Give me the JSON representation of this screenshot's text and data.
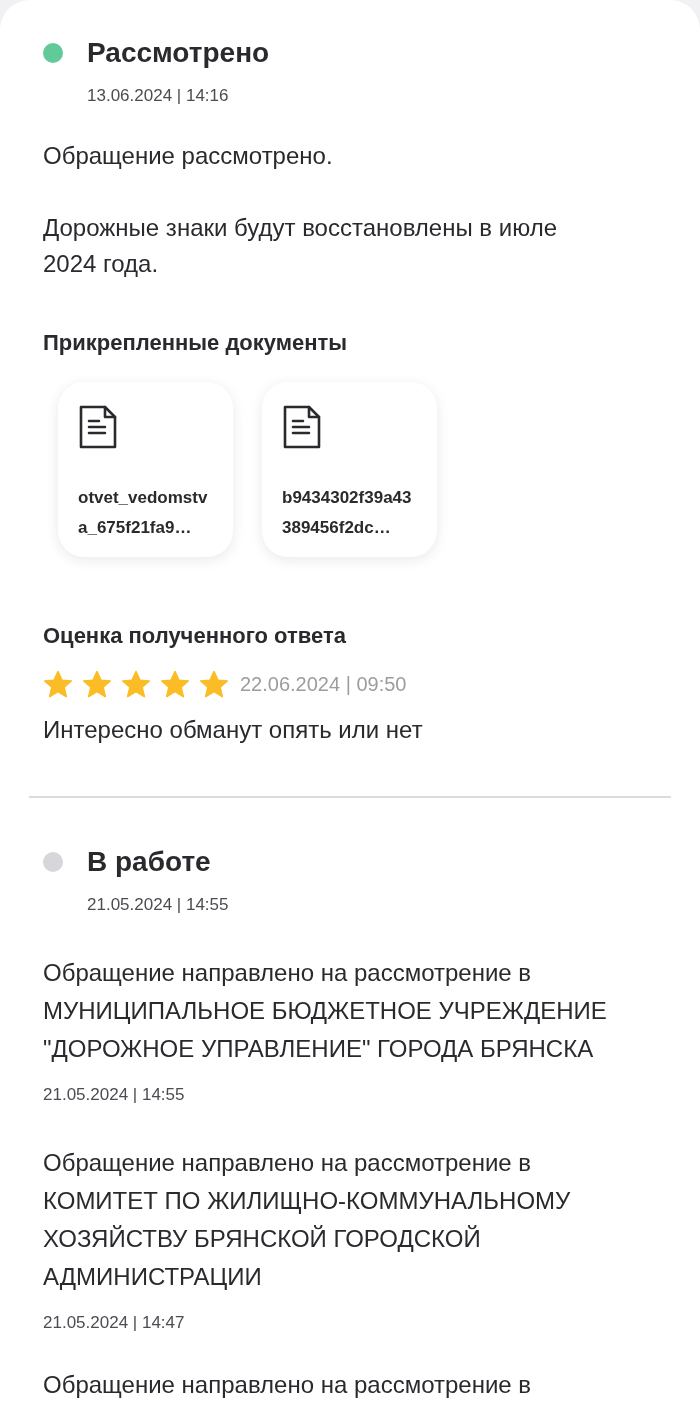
{
  "timeline": [
    {
      "title": "Рассмотрено",
      "color": "#62c99a",
      "date": "13.06.2024 | 14:16",
      "message": "Обращение рассмотрено.\n\nДорожные знаки будут восстановлены в июле 2024 года.",
      "attachments": {
        "heading": "Прикрепленные документы",
        "files": [
          {
            "name": "otvet_vedomstva_675f21fa9…"
          },
          {
            "name": "b9434302f39a43389456f2dc…"
          }
        ]
      },
      "rating": {
        "heading": "Оценка полученного ответа",
        "stars": 5,
        "date": "22.06.2024 | 09:50",
        "comment": "Интересно обманут опять или нет"
      }
    },
    {
      "title": "В работе",
      "color": "#d7d7db",
      "date": "21.05.2024 | 14:55",
      "events": [
        {
          "text": "Обращение направлено на рассмотрение в МУНИЦИПАЛЬНОЕ БЮДЖЕТНОЕ УЧРЕЖДЕНИЕ \"ДОРОЖНОЕ УПРАВЛЕНИЕ\" ГОРОДА БРЯНСКА",
          "date": "21.05.2024 | 14:55"
        },
        {
          "text": "Обращение направлено на рассмотрение в КОМИТЕТ ПО ЖИЛИЩНО-КОММУНАЛЬНОМУ ХОЗЯЙСТВУ БРЯНСКОЙ ГОРОДСКОЙ АДМИНИСТРАЦИИ",
          "date": "21.05.2024 | 14:47"
        },
        {
          "text": "Обращение направлено на рассмотрение в"
        }
      ]
    }
  ]
}
